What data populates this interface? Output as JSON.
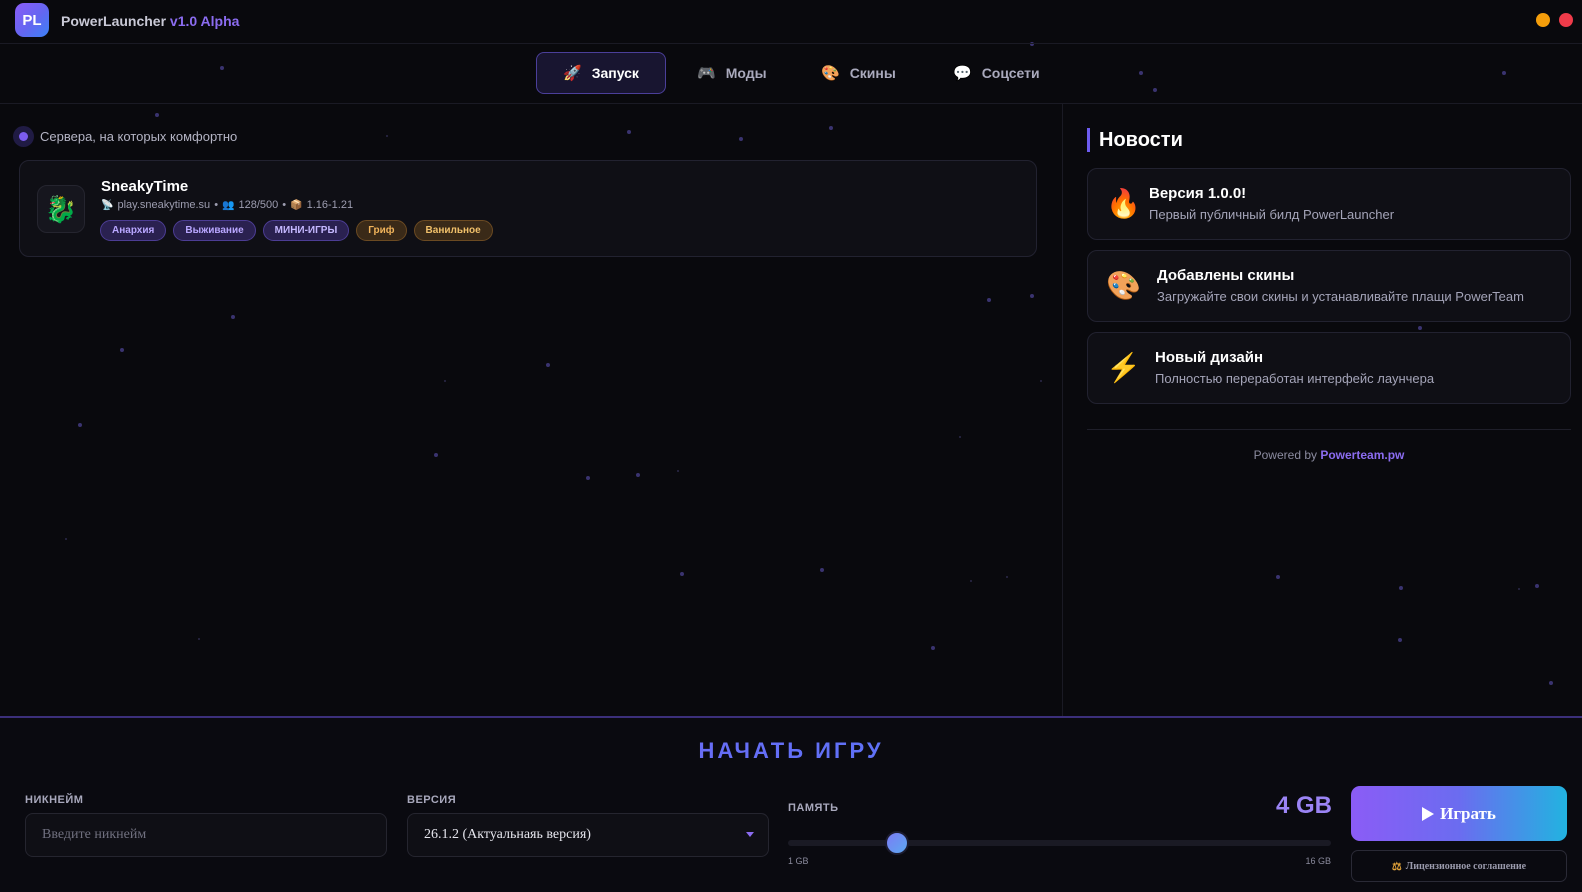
{
  "app": {
    "logo": "PL",
    "name": "PowerLauncher",
    "version": "v1.0 Alpha"
  },
  "nav": {
    "tabs": [
      {
        "label": "Запуск",
        "icon": "rocket-icon",
        "glyph": "🚀",
        "active": true
      },
      {
        "label": "Моды",
        "icon": "gamepad-icon",
        "glyph": "🎮",
        "active": false
      },
      {
        "label": "Скины",
        "icon": "palette-icon",
        "glyph": "🎨",
        "active": false
      },
      {
        "label": "Соцсети",
        "icon": "chat-icon",
        "glyph": "💬",
        "active": false
      }
    ]
  },
  "servers": {
    "section_label": "Сервера, на которых комфортно",
    "items": [
      {
        "name": "SneakyTime",
        "avatar_glyph": "🐉",
        "address": "play.sneakytime.su",
        "players": "128/500",
        "versions": "1.16-1.21",
        "tags": [
          "Анархия",
          "Выживание",
          "МИНИ-ИГРЫ",
          "Гриф",
          "Ванильное"
        ]
      }
    ]
  },
  "news": {
    "title": "Новости",
    "items": [
      {
        "icon": "fire-icon",
        "glyph": "🔥",
        "title": "Версия 1.0.0!",
        "text": "Первый публичный билд PowerLauncher"
      },
      {
        "icon": "palette-icon",
        "glyph": "🎨",
        "title": "Добавлены скины",
        "text": "Загружайте свои скины и устанавливайте плащи PowerTeam"
      },
      {
        "icon": "lightning-icon",
        "glyph": "⚡",
        "title": "Новый дизайн",
        "text": "Полностью переработан интерфейс лаунчера"
      }
    ],
    "powered_by": "Powered by",
    "powered_link": "Powerteam.pw"
  },
  "launch": {
    "title": "НАЧАТЬ ИГРУ",
    "nickname_label": "НИКНЕЙМ",
    "nickname_placeholder": "Введите никнейм",
    "nickname_value": "",
    "version_label": "ВЕРСИЯ",
    "version_value": "26.1.2 (Актуальнаяь версия)",
    "memory_label": "ПАМЯТЬ",
    "memory_value": "4 GB",
    "memory_min": "1 GB",
    "memory_max": "16 GB",
    "memory_fraction": 0.2,
    "play_label": "Играть",
    "license_label": "Лицензионное соглашение"
  },
  "colors": {
    "accent": "#8b5cf6",
    "accent_blue": "#3b82f6",
    "background": "#09090d",
    "window_minimize": "#f59e0b",
    "window_close": "#ef3b4a"
  }
}
